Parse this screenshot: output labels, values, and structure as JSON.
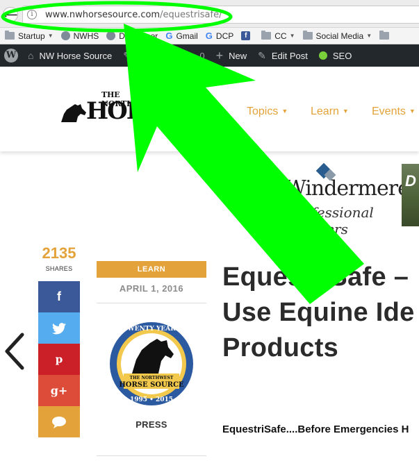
{
  "browser": {
    "url_host": "www.nwhorsesource.com",
    "url_path": "/equestrisafe/",
    "back_icon": "back-arrow-icon",
    "info_icon": "info-icon"
  },
  "bookmarks": [
    {
      "label": "Startup",
      "icon": "folder-icon",
      "has_caret": true
    },
    {
      "label": "NWHS",
      "icon": "globe-icon",
      "has_caret": false
    },
    {
      "label": "Disclaimer",
      "icon": "globe-icon",
      "has_caret": false
    },
    {
      "label": "Gmail",
      "icon": "google-icon",
      "has_caret": false
    },
    {
      "label": "DCP",
      "icon": "google-icon",
      "has_caret": false
    },
    {
      "label": "",
      "icon": "facebook-icon",
      "has_caret": false
    },
    {
      "label": "CC",
      "icon": "folder-icon",
      "has_caret": true
    },
    {
      "label": "Social Media",
      "icon": "folder-icon",
      "has_caret": true
    }
  ],
  "wpbar": {
    "site_name": "NW Horse Source",
    "customize": "Customize",
    "comments_count": "0",
    "new_label": "New",
    "edit_label": "Edit Post",
    "seo_label": "SEO"
  },
  "site": {
    "logo_top": "THE NORTHWEST",
    "logo_main": "HORSE",
    "nav": [
      {
        "label": "Topics"
      },
      {
        "label": "Learn"
      },
      {
        "label": "Events"
      }
    ]
  },
  "ad": {
    "brand": "Windermere",
    "sub": "professional partners",
    "photo_letter": "D"
  },
  "share": {
    "count": "2135",
    "label": "SHARES",
    "buttons": [
      {
        "name": "facebook",
        "glyph": "f",
        "color": "#3b5998"
      },
      {
        "name": "twitter",
        "glyph": "🐦",
        "color": "#55acee"
      },
      {
        "name": "pinterest",
        "glyph": "P",
        "color": "#cb2027"
      },
      {
        "name": "google-plus",
        "glyph": "g+",
        "color": "#dd4b39"
      },
      {
        "name": "comment",
        "glyph": "💬",
        "color": "#e4a33a"
      }
    ]
  },
  "post": {
    "category": "LEARN",
    "date": "APRIL 1, 2016",
    "author": "PRESS",
    "badge_top": "TWENTY YEARS",
    "badge_mid1": "THE NORTHWEST",
    "badge_mid2": "HORSE SOURCE",
    "badge_years": "1995 • 2015",
    "title": "EquestriSafe – \nUse Equine Ide\nProducts",
    "lead": "EquestriSafe....Before Emergencies H"
  },
  "colors": {
    "accent": "#e4a33a",
    "highlight": "#00ff00",
    "wpbar": "#23282d"
  }
}
